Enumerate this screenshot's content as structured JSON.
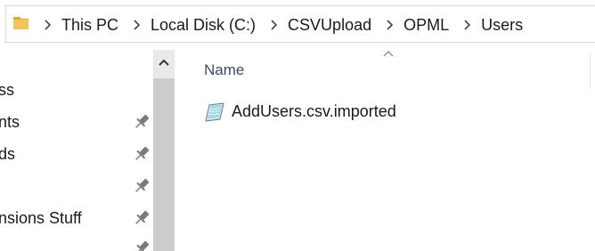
{
  "address_bar": {
    "breadcrumbs": [
      "This PC",
      "Local Disk (C:)",
      "CSVUpload",
      "OPML",
      "Users"
    ]
  },
  "nav_pane": {
    "items": [
      {
        "label": "ss",
        "pinned": false
      },
      {
        "label": "nts",
        "pinned": true
      },
      {
        "label": "ds",
        "pinned": true
      },
      {
        "label": "",
        "pinned": true
      },
      {
        "label": "nsions Stuff",
        "pinned": true
      },
      {
        "label": "",
        "pinned": true
      }
    ]
  },
  "columns": {
    "name_header": "Name",
    "sort": "ascending"
  },
  "files": [
    {
      "name": "AddUsers.csv.imported",
      "icon": "csv-file-icon"
    }
  ],
  "colors": {
    "folder": "#e8b33a",
    "header_text": "#3c4b60",
    "scrollbar_track": "#cdcdcd"
  }
}
